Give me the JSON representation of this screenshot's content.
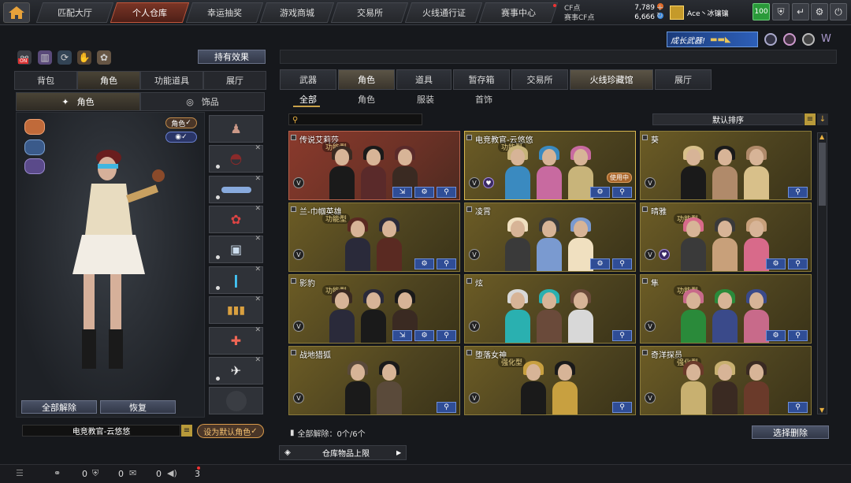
{
  "nav": {
    "tabs": [
      "匹配大厅",
      "个人仓库",
      "幸运抽奖",
      "游戏商城",
      "交易所",
      "火线通行证",
      "赛事中心"
    ],
    "active": "个人仓库"
  },
  "currency": {
    "cf_label": "CF点",
    "cf_value": "7,789",
    "event_label": "赛事CF点",
    "event_value": "6,666"
  },
  "user": {
    "name": "Ace丶冰镶镶",
    "level": "100"
  },
  "promo_banner": "成长武器!",
  "left": {
    "on_badge": "ON",
    "hold_effect_button": "持有效果",
    "tabs": [
      "背包",
      "角色",
      "功能道具",
      "展厅"
    ],
    "active_tab": "角色",
    "subtabs": [
      "角色",
      "饰品"
    ],
    "role_toggle": "角色",
    "unequip_all": "全部解除",
    "restore": "恢复",
    "selected_name": "电竞教官-云悠悠",
    "set_default": "设为默认角色"
  },
  "right": {
    "tabs": [
      "武器",
      "角色",
      "道具",
      "暂存箱",
      "交易所",
      "火线珍藏馆",
      "展厅"
    ],
    "active_tab": "角色",
    "filters": [
      "全部",
      "角色",
      "服装",
      "首饰"
    ],
    "active_filter": "全部",
    "sort_label": "默认排序",
    "cards": [
      {
        "name": "传说艾莉莎",
        "tag": "功能型",
        "use": "",
        "buttons": 3,
        "style": "red"
      },
      {
        "name": "电竞教官-云悠悠",
        "tag": "功能型",
        "use": "使用中",
        "buttons": 2,
        "style": "gold"
      },
      {
        "name": "葵",
        "tag": "",
        "use": "",
        "buttons": 1,
        "style": "gold"
      },
      {
        "name": "兰-巾帼英雄",
        "tag": "功能型",
        "use": "",
        "buttons": 2,
        "style": "gold"
      },
      {
        "name": "凌霄",
        "tag": "",
        "use": "",
        "buttons": 2,
        "style": "gold"
      },
      {
        "name": "晴雅",
        "tag": "功能型",
        "use": "",
        "buttons": 2,
        "style": "gold"
      },
      {
        "name": "影豹",
        "tag": "功能型",
        "use": "",
        "buttons": 3,
        "style": "gold"
      },
      {
        "name": "炫",
        "tag": "",
        "use": "",
        "buttons": 1,
        "style": "gold"
      },
      {
        "name": "隼",
        "tag": "功能型",
        "use": "",
        "buttons": 2,
        "style": "gold"
      },
      {
        "name": "战地猎狐",
        "tag": "",
        "use": "",
        "buttons": 1,
        "style": "gold"
      },
      {
        "name": "堕落女神",
        "tag": "强化型",
        "use": "",
        "buttons": 1,
        "style": "gold"
      },
      {
        "name": "奇洋探员",
        "tag": "强化型",
        "use": "",
        "buttons": 1,
        "style": "gold"
      }
    ],
    "unequip_status": "全部解除：0个/6个",
    "select_delete": "选择删除",
    "storage_limit": "仓库物品上限"
  },
  "bottom": {
    "counts": [
      "0",
      "0",
      "0",
      "3"
    ]
  },
  "colors": {
    "accent_red": "#c2563b",
    "card_gold": "#6c5c25",
    "button_blue": "#2f4d96",
    "level_green": "#2a9a3a"
  }
}
